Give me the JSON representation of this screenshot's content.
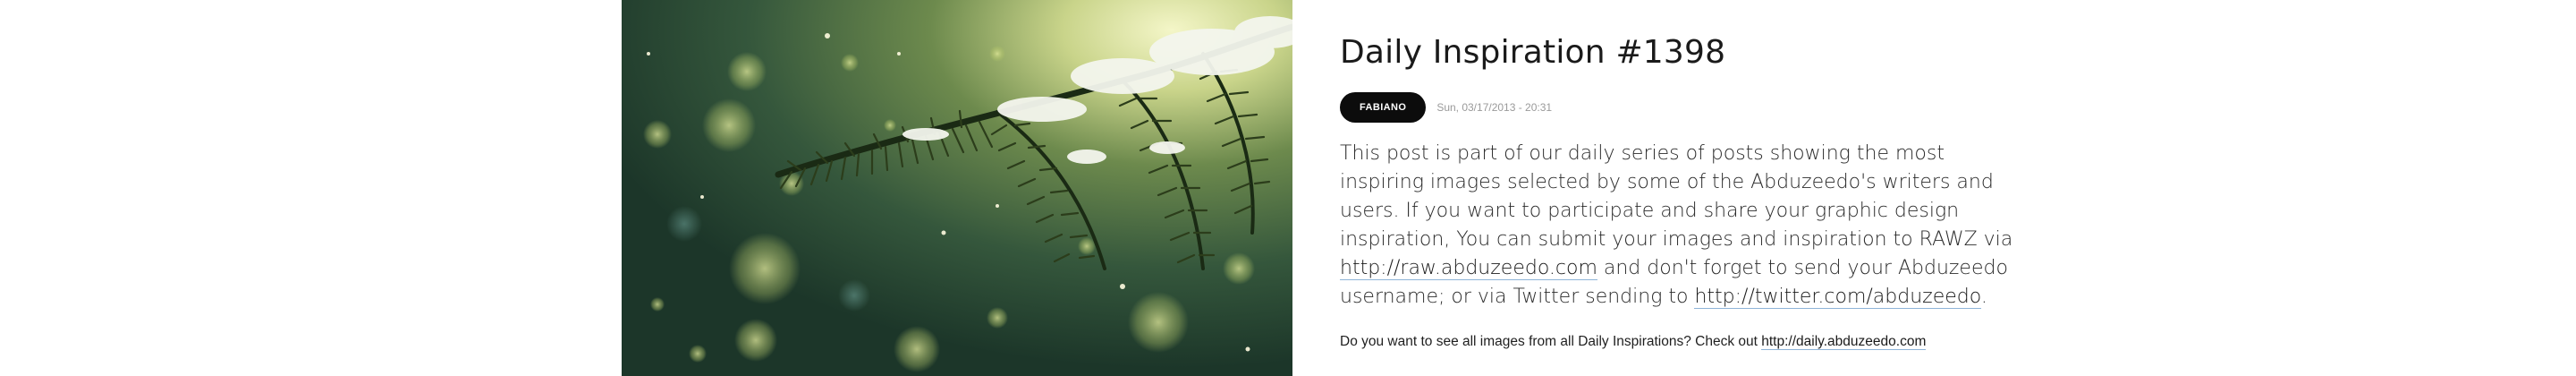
{
  "post": {
    "title": "Daily Inspiration #1398",
    "author": "FABIANO",
    "date": "Sun, 03/17/2013 - 20:31",
    "body": {
      "text_1": "This post is part of our daily series of posts showing the most inspiring images selected by some of the Abduzeedo's writers and users. If you want to participate and share your graphic design inspiration, You can submit your images and inspiration to RAWZ via ",
      "link_1": "http://raw.abduzeedo.com",
      "text_2": " and don't forget to send your Abduzeedo username; or via Twitter sending to ",
      "link_2": "http://twitter.com/abduzeedo",
      "text_3": "."
    },
    "footer": {
      "text": "Do you want to see all images from all Daily Inspirations? Check out ",
      "link": "http://daily.abduzeedo.com"
    }
  },
  "image": {
    "subject": "snow-covered-pine-branch",
    "colors": {
      "dark_green": "#1f3a2a",
      "mid_green": "#4d6b3c",
      "light_yellow": "#e6ecb0",
      "snow": "#f4f6ee"
    }
  }
}
